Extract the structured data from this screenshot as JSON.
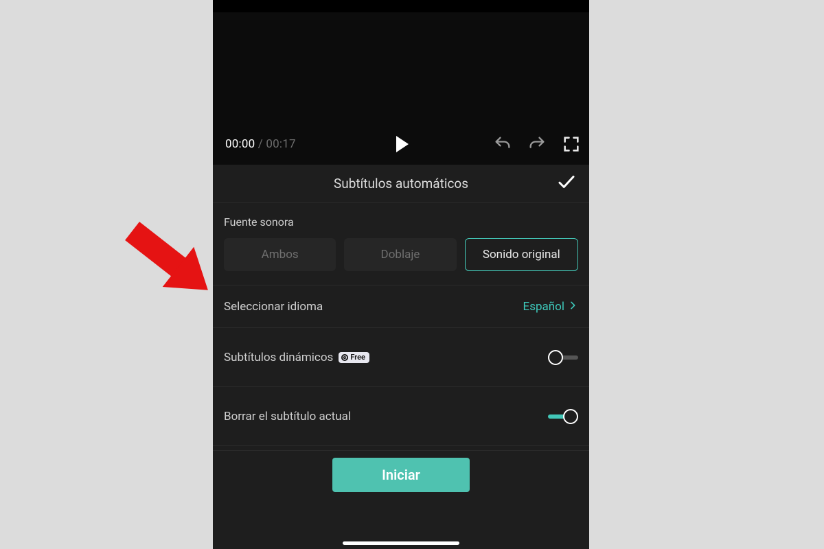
{
  "timebar": {
    "current": "00:00",
    "separator": " / ",
    "total": "00:17"
  },
  "panel": {
    "title": "Subtítulos automáticos"
  },
  "source": {
    "label": "Fuente sonora",
    "options": [
      "Ambos",
      "Doblaje",
      "Sonido original"
    ],
    "selected_index": 2
  },
  "language": {
    "label": "Seleccionar idioma",
    "value": "Español"
  },
  "dynamic": {
    "label": "Subtítulos dinámicos",
    "badge": "Free",
    "on": false
  },
  "clear": {
    "label": "Borrar el subtítulo actual",
    "on": true
  },
  "primary_button": "Iniciar"
}
